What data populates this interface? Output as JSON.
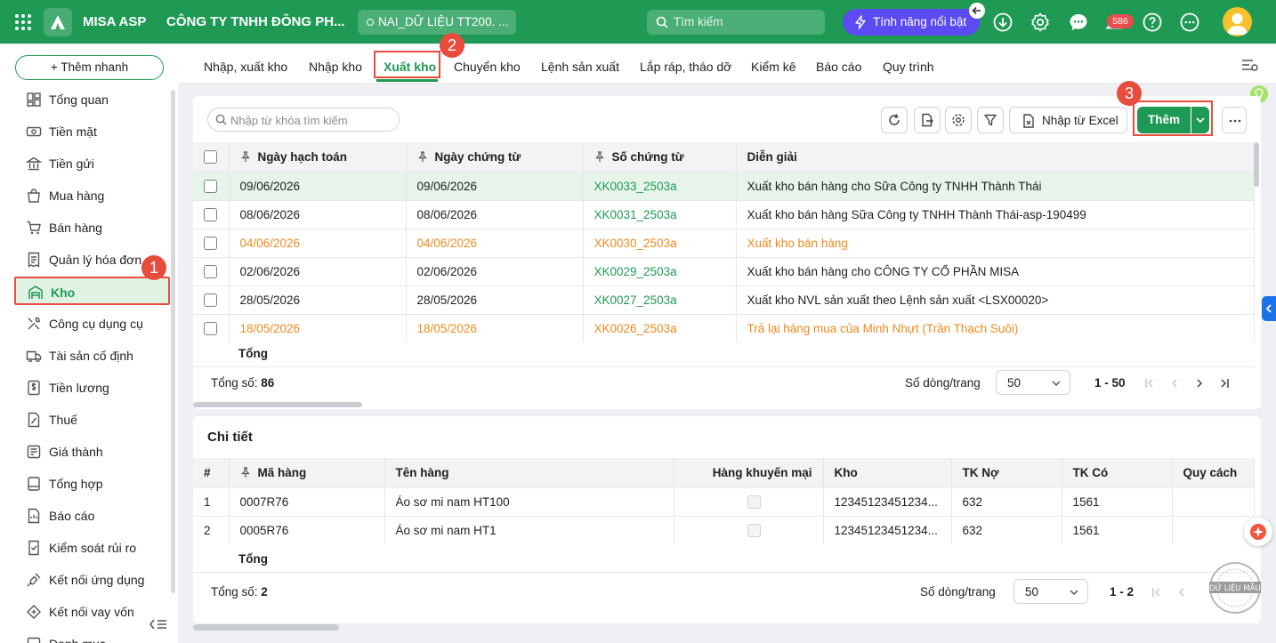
{
  "topbar": {
    "brand": "MISA ASP",
    "company": "CÔNG TY TNHH ĐÔNG PH...",
    "database": "NAI_DỮ LIỆU TT200. ...",
    "search_placeholder": "Tìm kiếm",
    "feature_button": "Tính năng nổi bật",
    "notification_count": "586",
    "accent_color": "#1f9a55",
    "icons": [
      "apps-grid-icon",
      "misa-logo-icon",
      "search-icon",
      "lightning-icon",
      "back-arrow-icon",
      "download-icon",
      "gear-icon",
      "chat-icon",
      "notification-icon",
      "help-icon",
      "more-icon",
      "user-avatar"
    ]
  },
  "sidebar": {
    "quick_add": "+ Thêm nhanh",
    "items": [
      {
        "label": "Tổng quan",
        "icon": "dashboard-icon"
      },
      {
        "label": "Tiền mặt",
        "icon": "cash-icon"
      },
      {
        "label": "Tiền gửi",
        "icon": "bank-icon"
      },
      {
        "label": "Mua hàng",
        "icon": "shopping-bag-icon"
      },
      {
        "label": "Bán hàng",
        "icon": "cart-icon"
      },
      {
        "label": "Quản lý hóa đơn",
        "icon": "invoice-icon"
      },
      {
        "label": "Kho",
        "icon": "warehouse-icon",
        "active": true
      },
      {
        "label": "Công cụ dụng cụ",
        "icon": "tools-icon"
      },
      {
        "label": "Tài sản cố định",
        "icon": "truck-icon"
      },
      {
        "label": "Tiền lương",
        "icon": "salary-icon"
      },
      {
        "label": "Thuế",
        "icon": "tax-icon"
      },
      {
        "label": "Giá thành",
        "icon": "cost-icon"
      },
      {
        "label": "Tổng hợp",
        "icon": "summary-icon"
      },
      {
        "label": "Báo cáo",
        "icon": "report-icon"
      },
      {
        "label": "Kiểm soát rủi ro",
        "icon": "risk-icon"
      },
      {
        "label": "Kết nối ứng dụng",
        "icon": "plug-icon"
      },
      {
        "label": "Kết nối vay vốn",
        "icon": "loan-icon"
      },
      {
        "label": "Danh mục",
        "icon": "catalog-icon"
      }
    ]
  },
  "tabs": [
    {
      "label": "Nhập, xuất kho"
    },
    {
      "label": "Nhập kho"
    },
    {
      "label": "Xuất kho",
      "active": true
    },
    {
      "label": "Chuyển kho"
    },
    {
      "label": "Lệnh sản xuất"
    },
    {
      "label": "Lắp ráp, tháo dỡ"
    },
    {
      "label": "Kiểm kê"
    },
    {
      "label": "Báo cáo"
    },
    {
      "label": "Quy trình"
    }
  ],
  "steps": [
    "1",
    "2",
    "3"
  ],
  "toolbar": {
    "search_placeholder": "Nhập từ khóa tìm kiếm",
    "import_excel": "Nhập từ Excel",
    "add": "Thêm"
  },
  "grid": {
    "columns": [
      "Ngày hạch toán",
      "Ngày chứng từ",
      "Số chứng từ",
      "Diễn giải"
    ],
    "rows": [
      {
        "posting_date": "09/06/2026",
        "doc_date": "09/06/2026",
        "doc_no": "XK0033_2503a",
        "desc": "Xuất kho bán hàng cho Sữa Công ty TNHH Thành Thái",
        "selected": true
      },
      {
        "posting_date": "08/06/2026",
        "doc_date": "08/06/2026",
        "doc_no": "XK0031_2503a",
        "desc": "Xuất kho bán hàng Sữa Công ty TNHH Thành Thái-asp-190499"
      },
      {
        "posting_date": "04/06/2026",
        "doc_date": "04/06/2026",
        "doc_no": "XK0030_2503a",
        "desc": "Xuất kho bán hàng",
        "orange": true
      },
      {
        "posting_date": "02/06/2026",
        "doc_date": "02/06/2026",
        "doc_no": "XK0029_2503a",
        "desc": "Xuất kho bán hàng cho CÔNG TY CỔ PHẦN MISA"
      },
      {
        "posting_date": "28/05/2026",
        "doc_date": "28/05/2026",
        "doc_no": "XK0027_2503a",
        "desc": "Xuất kho NVL sản xuất theo Lệnh sản xuất <LSX00020>"
      },
      {
        "posting_date": "18/05/2026",
        "doc_date": "18/05/2026",
        "doc_no": "XK0026_2503a",
        "desc": "Trả lại hàng mua của Minh Nhựt (Trần Thạch Suôi)",
        "orange": true
      }
    ],
    "total_label": "Tổng",
    "count_label": "Tổng số:",
    "count_value": "86",
    "page_size_label": "Số dòng/trang",
    "page_size": "50",
    "range": "1 - 50"
  },
  "detail": {
    "title": "Chi tiết",
    "columns": [
      "#",
      "Mã hàng",
      "Tên hàng",
      "Hàng khuyến mại",
      "Kho",
      "TK Nợ",
      "TK Có",
      "Quy cách"
    ],
    "rows": [
      {
        "no": "1",
        "code": "0007R76",
        "name": "Áo sơ mi nam HT100",
        "warehouse": "12345123451234...",
        "debit": "632",
        "credit": "1561"
      },
      {
        "no": "2",
        "code": "0005R76",
        "name": "Áo sơ mi nam HT1",
        "warehouse": "12345123451234...",
        "debit": "632",
        "credit": "1561"
      }
    ],
    "total_label": "Tổng",
    "count_label": "Tổng số:",
    "count_value": "2",
    "page_size_label": "Số dòng/trang",
    "page_size": "50",
    "range": "1 - 2",
    "stamp_text": "DỮ LIỆU MẪU"
  }
}
